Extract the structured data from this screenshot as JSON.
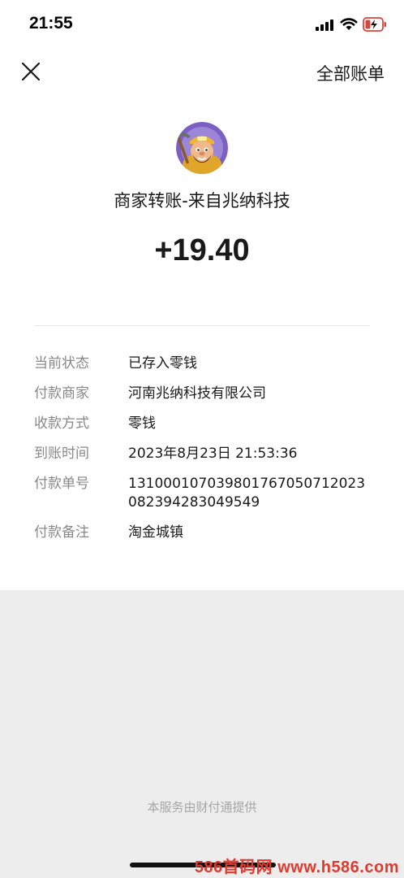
{
  "status_bar": {
    "time": "21:55"
  },
  "nav": {
    "close_icon": "close-icon",
    "all_bills": "全部账单"
  },
  "merchant": {
    "avatar_icon": "merchant-avatar",
    "title": "商家转账-来自兆纳科技",
    "amount": "+19.40"
  },
  "details": [
    {
      "label": "当前状态",
      "value": "已存入零钱"
    },
    {
      "label": "付款商家",
      "value": "河南兆纳科技有限公司"
    },
    {
      "label": "收款方式",
      "value": "零钱"
    },
    {
      "label": "到账时间",
      "value": "2023年8月23日 21:53:36"
    },
    {
      "label": "付款单号",
      "value": "1310001070398017670507120230823942830495​49"
    },
    {
      "label": "付款备注",
      "value": "淘金城镇"
    }
  ],
  "footer": {
    "service_note": "本服务由财付通提供"
  },
  "watermark": "586首码网 www.h586.com",
  "colors": {
    "background": "#ededed",
    "card": "#ffffff",
    "label": "#888888",
    "watermark": "#e03a2f"
  }
}
